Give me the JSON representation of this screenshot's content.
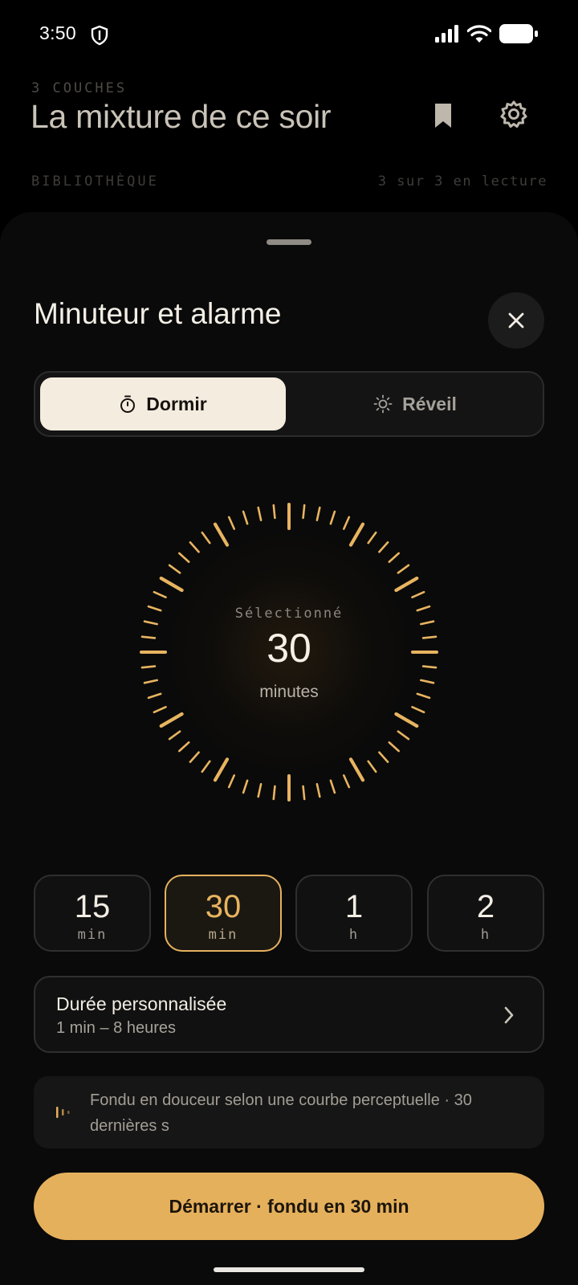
{
  "status_bar": {
    "time": "3:50",
    "icons": [
      "shield-icon",
      "signal-icon",
      "wifi-icon",
      "battery-icon"
    ]
  },
  "background": {
    "eyebrow": "3 COUCHES",
    "title": "La mixture de ce soir",
    "library_label": "BIBLIOTHÈQUE",
    "playing_status": "3 sur 3 en lecture"
  },
  "sheet": {
    "title": "Minuteur et alarme",
    "tabs": [
      {
        "label": "Dormir",
        "icon": "stopwatch-icon",
        "selected": true
      },
      {
        "label": "Réveil",
        "icon": "sun-icon",
        "selected": false
      }
    ],
    "dial": {
      "label": "Sélectionné",
      "value": "30",
      "unit": "minutes",
      "tick_count": 60,
      "accent": "#e8b460"
    },
    "presets": [
      {
        "value": "15",
        "unit": "min",
        "selected": false
      },
      {
        "value": "30",
        "unit": "min",
        "selected": true
      },
      {
        "value": "1",
        "unit": "h",
        "selected": false
      },
      {
        "value": "2",
        "unit": "h",
        "selected": false
      }
    ],
    "custom": {
      "title": "Durée personnalisée",
      "subtitle": "1 min – 8 heures"
    },
    "info_text": "Fondu en douceur selon une courbe perceptuelle · 30 dernières s",
    "start_button": "Démarrer · fondu en 30 min"
  },
  "colors": {
    "accent": "#e5b05c",
    "background": "#000000",
    "sheet": "#0a0a0a",
    "selected_tab": "#f5ece0"
  }
}
